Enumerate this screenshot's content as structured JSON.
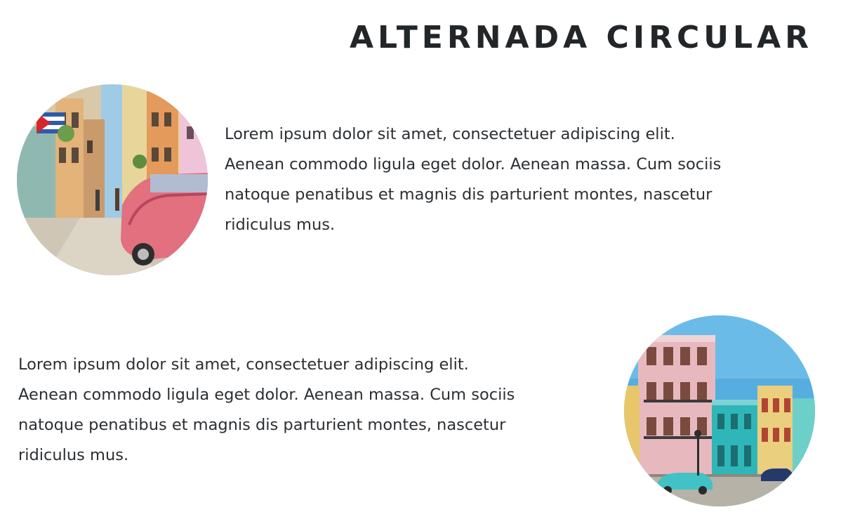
{
  "page": {
    "title": "ALTERNADA CIRCULAR"
  },
  "sections": [
    {
      "image_icon": "havana-street-photo",
      "lines": [
        "Lorem ipsum dolor sit amet, consectetuer adipiscing elit.",
        "Aenean commodo ligula eget dolor. Aenean massa. Cum sociis",
        "natoque penatibus et magnis dis parturient montes, nascetur",
        "ridiculus mus."
      ]
    },
    {
      "image_icon": "havana-buildings-photo",
      "lines": [
        "Lorem ipsum dolor sit amet, consectetuer adipiscing elit.",
        "Aenean commodo ligula eget dolor. Aenean massa. Cum sociis",
        "natoque penatibus et magnis dis parturient montes, nascetur",
        "ridiculus mus."
      ]
    }
  ],
  "colors": {
    "title": "#232629",
    "text": "#2b2f33",
    "background": "#ffffff"
  }
}
